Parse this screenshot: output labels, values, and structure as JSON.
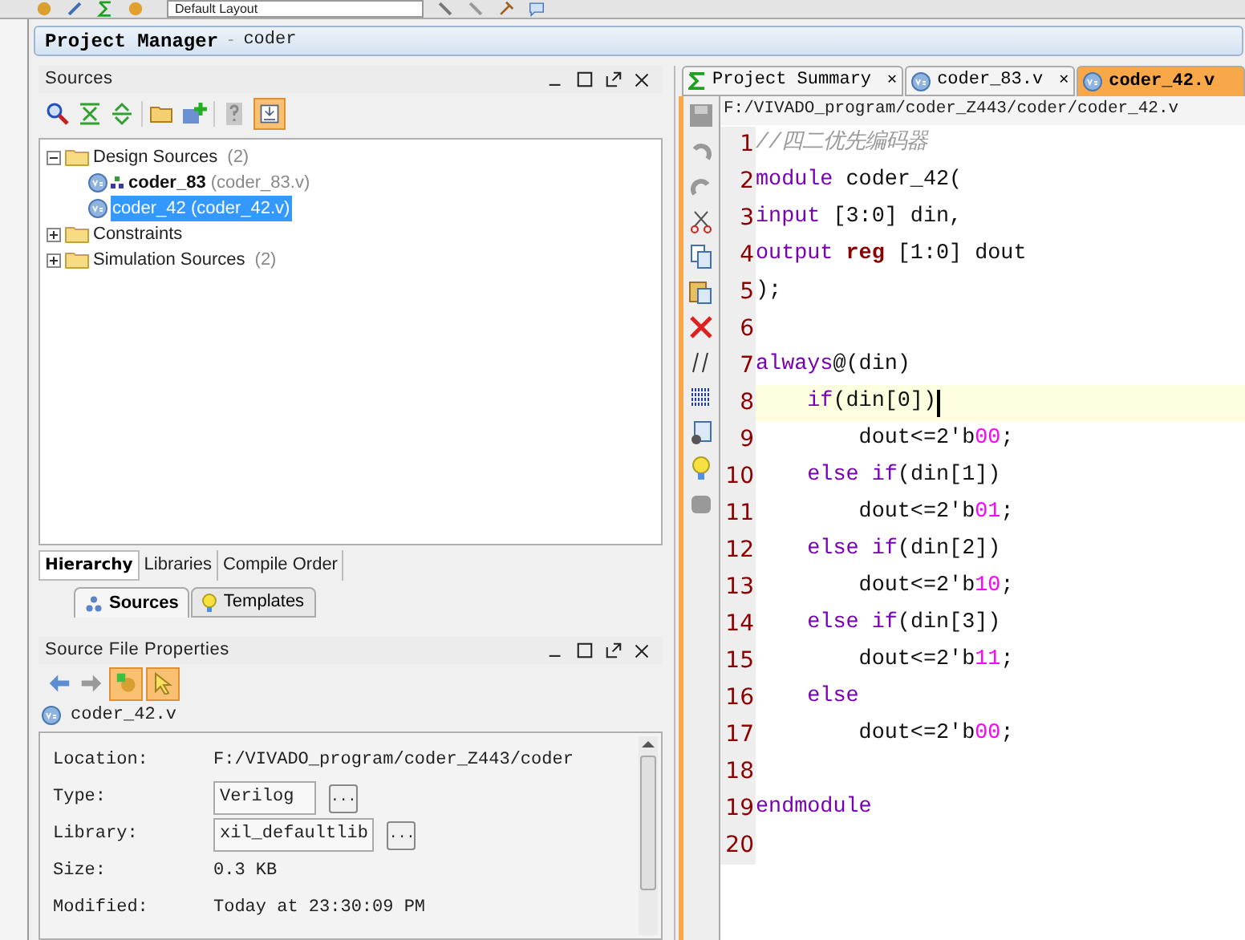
{
  "toolbar": {
    "layout_dropdown": "Default Layout"
  },
  "project_manager": {
    "title": "Project Manager",
    "separator": "-",
    "subtitle": "coder"
  },
  "sources_panel": {
    "title": "Sources",
    "tree": [
      {
        "label": "Design Sources",
        "count": "(2)",
        "expanded": true,
        "children": [
          {
            "label": "coder_83",
            "file": "(coder_83.v)",
            "top": true,
            "selected": false
          },
          {
            "label": "coder_42",
            "file": "(coder_42.v)",
            "top": false,
            "selected": true
          }
        ]
      },
      {
        "label": "Constraints",
        "expanded": false
      },
      {
        "label": "Simulation Sources",
        "count": "(2)",
        "expanded": false
      }
    ],
    "view_tabs": [
      {
        "label": "Hierarchy",
        "selected": true
      },
      {
        "label": "Libraries",
        "selected": false
      },
      {
        "label": "Compile Order",
        "selected": false
      }
    ],
    "bottom_tabs": [
      {
        "label": "Sources",
        "selected": true,
        "kind": "sources"
      },
      {
        "label": "Templates",
        "selected": false,
        "kind": "templates"
      }
    ]
  },
  "properties_panel": {
    "title": "Source File Properties",
    "file": "coder_42.v",
    "fields": [
      {
        "label": "Location:",
        "value": "F:/VIVADO_program/coder_Z443/coder",
        "kind": "text"
      },
      {
        "label": "Type:",
        "value": "Verilog",
        "kind": "field"
      },
      {
        "label": "Library:",
        "value": "xil_defaultlib",
        "kind": "field"
      },
      {
        "label": "Size:",
        "value": "0.3 KB",
        "kind": "text"
      },
      {
        "label": "Modified:",
        "value": "Today at 23:30:09 PM",
        "kind": "text"
      }
    ],
    "browse_button": "..."
  },
  "editor": {
    "tabs": [
      {
        "label": "Project Summary",
        "selected": false,
        "kind": "summary"
      },
      {
        "label": "coder_83.v",
        "selected": false,
        "kind": "verilog"
      },
      {
        "label": "coder_42.v",
        "selected": true,
        "kind": "verilog"
      }
    ],
    "close_glyph": "✕",
    "path": "F:/VIVADO_program/coder_Z443/coder/coder_42.v",
    "lines": [
      {
        "number": "1",
        "current": false,
        "tokens": [
          {
            "kind": "comment",
            "text": "//四二优先编码器"
          }
        ]
      },
      {
        "number": "2",
        "current": false,
        "tokens": [
          {
            "kind": "keyword",
            "text": "module"
          },
          {
            "kind": "plain",
            "text": " coder_42("
          }
        ]
      },
      {
        "number": "3",
        "current": false,
        "tokens": [
          {
            "kind": "keyword",
            "text": "input"
          },
          {
            "kind": "plain",
            "text": " [3:0] din,"
          }
        ]
      },
      {
        "number": "4",
        "current": false,
        "tokens": [
          {
            "kind": "keyword",
            "text": "output "
          },
          {
            "kind": "type",
            "text": "reg"
          },
          {
            "kind": "plain",
            "text": " [1:0] dout"
          }
        ]
      },
      {
        "number": "5",
        "current": false,
        "tokens": [
          {
            "kind": "plain",
            "text": ");"
          }
        ]
      },
      {
        "number": "6",
        "current": false
      },
      {
        "number": "7",
        "current": false,
        "tokens": [
          {
            "kind": "keyword",
            "text": "always"
          },
          {
            "kind": "plain",
            "text": "@(din)"
          }
        ]
      },
      {
        "number": "8",
        "current": true,
        "tokens": [
          {
            "kind": "keyword",
            "text": "    if"
          },
          {
            "kind": "plain",
            "text": "(din[0])"
          }
        ]
      },
      {
        "number": "9",
        "current": false,
        "tokens": [
          {
            "kind": "plain",
            "text": "        dout<=2'b"
          },
          {
            "kind": "number",
            "text": "00"
          },
          {
            "kind": "plain",
            "text": ";"
          }
        ]
      },
      {
        "number": "10",
        "current": false,
        "tokens": [
          {
            "kind": "keyword",
            "text": "    else if"
          },
          {
            "kind": "plain",
            "text": "(din[1])"
          }
        ]
      },
      {
        "number": "11",
        "current": false,
        "tokens": [
          {
            "kind": "plain",
            "text": "        dout<=2'b"
          },
          {
            "kind": "number",
            "text": "01"
          },
          {
            "kind": "plain",
            "text": ";"
          }
        ]
      },
      {
        "number": "12",
        "current": false,
        "tokens": [
          {
            "kind": "keyword",
            "text": "    else if"
          },
          {
            "kind": "plain",
            "text": "(din[2])"
          }
        ]
      },
      {
        "number": "13",
        "current": false,
        "tokens": [
          {
            "kind": "plain",
            "text": "        dout<=2'b"
          },
          {
            "kind": "number",
            "text": "10"
          },
          {
            "kind": "plain",
            "text": ";"
          }
        ]
      },
      {
        "number": "14",
        "current": false,
        "tokens": [
          {
            "kind": "keyword",
            "text": "    else if"
          },
          {
            "kind": "plain",
            "text": "(din[3])"
          }
        ]
      },
      {
        "number": "15",
        "current": false,
        "tokens": [
          {
            "kind": "plain",
            "text": "        dout<=2'b"
          },
          {
            "kind": "number",
            "text": "11"
          },
          {
            "kind": "plain",
            "text": ";"
          }
        ]
      },
      {
        "number": "16",
        "current": false,
        "tokens": [
          {
            "kind": "keyword",
            "text": "    else"
          }
        ]
      },
      {
        "number": "17",
        "current": false,
        "tokens": [
          {
            "kind": "plain",
            "text": "        dout<=2'b"
          },
          {
            "kind": "number",
            "text": "00"
          },
          {
            "kind": "plain",
            "text": ";"
          }
        ]
      },
      {
        "number": "18",
        "current": false
      },
      {
        "number": "19",
        "current": false,
        "tokens": [
          {
            "kind": "keyword",
            "text": "endmodule"
          }
        ]
      },
      {
        "number": "20",
        "current": false
      }
    ]
  }
}
